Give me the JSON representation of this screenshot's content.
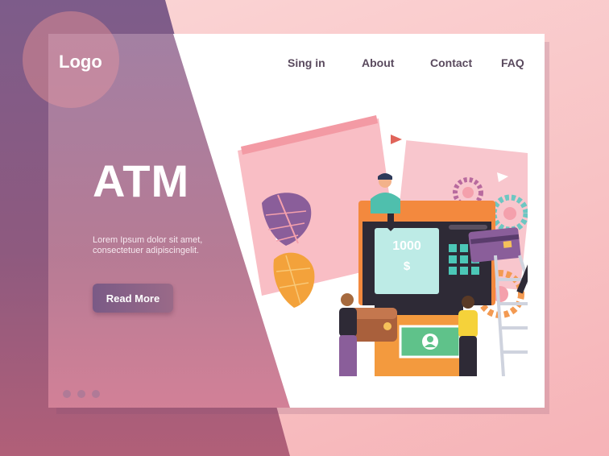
{
  "background": {
    "left_color": "#7d5c8a",
    "right_color": "#f8c2c4"
  },
  "header": {
    "logo": "Logo",
    "nav": [
      "Sing in",
      "About",
      "Contact",
      "FAQ"
    ]
  },
  "hero": {
    "title": "ATM",
    "description": "Lorem Ipsum dolor sit amet, consectetuer adipiscingelit.",
    "button": "Read More"
  },
  "illustration": {
    "name": "atm-illustration",
    "screen_amount": "1000",
    "screen_currency": "$"
  },
  "pagination_dots": 3
}
